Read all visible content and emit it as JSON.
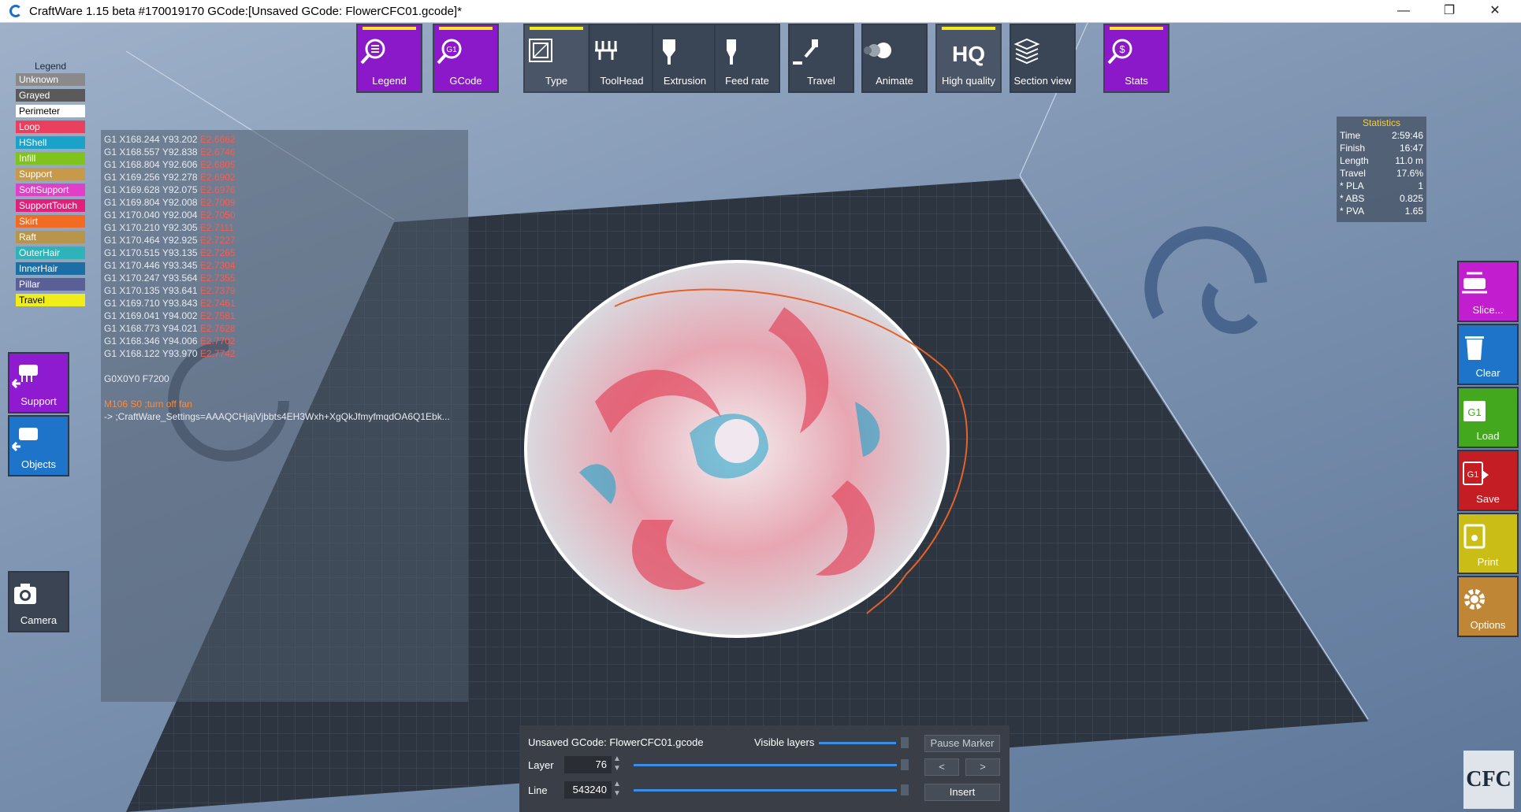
{
  "window": {
    "title": "CraftWare 1.15 beta #170019170   GCode:[Unsaved GCode: FlowerCFC01.gcode]*",
    "minimize": "—",
    "restore": "❐",
    "close": "✕"
  },
  "legend": {
    "header": "Legend",
    "items": [
      {
        "label": "Unknown",
        "color": "#8a8a8a"
      },
      {
        "label": "Grayed",
        "color": "#5a5a5a"
      },
      {
        "label": "Perimeter",
        "color": "#ffffff"
      },
      {
        "label": "Loop",
        "color": "#e9405e"
      },
      {
        "label": "HShell",
        "color": "#1aa2c9"
      },
      {
        "label": "Infill",
        "color": "#7fc31c"
      },
      {
        "label": "Support",
        "color": "#c79a4b"
      },
      {
        "label": "SoftSupport",
        "color": "#e13fc7"
      },
      {
        "label": "SupportTouch",
        "color": "#e0207a"
      },
      {
        "label": "Skirt",
        "color": "#f36a21"
      },
      {
        "label": "Raft",
        "color": "#b8954a"
      },
      {
        "label": "OuterHair",
        "color": "#2db3b8"
      },
      {
        "label": "InnerHair",
        "color": "#1b6fa6"
      },
      {
        "label": "Pillar",
        "color": "#5a5f95"
      },
      {
        "label": "Travel",
        "color": "#f0ee1a"
      }
    ]
  },
  "gcode": {
    "lines": [
      [
        "G1 X168.244 Y93.202 ",
        "E2.6662"
      ],
      [
        "G1 X168.557 Y92.838 ",
        "E2.6746"
      ],
      [
        "G1 X168.804 Y92.606 ",
        "E2.6805"
      ],
      [
        "G1 X169.256 Y92.278 ",
        "E2.6902"
      ],
      [
        "G1 X169.628 Y92.075 ",
        "E2.6976"
      ],
      [
        "G1 X169.804 Y92.008 ",
        "E2.7009"
      ],
      [
        "G1 X170.040 Y92.004 ",
        "E2.7050"
      ],
      [
        "G1 X170.210 Y92.305 ",
        "E2.7111"
      ],
      [
        "G1 X170.464 Y92.925 ",
        "E2.7227"
      ],
      [
        "G1 X170.515 Y93.135 ",
        "E2.7265"
      ],
      [
        "G1 X170.446 Y93.345 ",
        "E2.7304"
      ],
      [
        "G1 X170.247 Y93.564 ",
        "E2.7355"
      ],
      [
        "G1 X170.135 Y93.641 ",
        "E2.7379"
      ],
      [
        "G1 X169.710 Y93.843 ",
        "E2.7461"
      ],
      [
        "G1 X169.041 Y94.002 ",
        "E2.7581"
      ],
      [
        "G1 X168.773 Y94.021 ",
        "E2.7628"
      ],
      [
        "G1 X168.346 Y94.006 ",
        "E2.7702"
      ],
      [
        "G1 X168.122 Y93.970 ",
        "E2.7742"
      ]
    ],
    "g0": "G0X0Y0 F7200",
    "m106": "M106 S0 ;turn off fan",
    "settings": "-> ;CraftWare_Settings=AAAQCHjajVjbbts4EH3Wxh+XgQkJfmyfmqdOA6Q1Ebk..."
  },
  "toolbar": {
    "legend": "Legend",
    "gcode": "GCode",
    "type": "Type",
    "toolhead": "ToolHead",
    "extrusion": "Extrusion",
    "feedrate": "Feed rate",
    "travel": "Travel",
    "animate": "Animate",
    "hq_icon": "HQ",
    "hq": "High quality",
    "section": "Section view",
    "stats": "Stats"
  },
  "statistics": {
    "header": "Statistics",
    "rows": [
      {
        "k": "Time",
        "v": "2:59:46"
      },
      {
        "k": "Finish",
        "v": "16:47"
      },
      {
        "k": "Length",
        "v": "11.0 m"
      },
      {
        "k": "Travel",
        "v": "17.6%"
      },
      {
        "k": " * PLA",
        "v": "1"
      },
      {
        "k": " * ABS",
        "v": "0.825"
      },
      {
        "k": " * PVA",
        "v": "1.65"
      }
    ]
  },
  "left_buttons": {
    "support": "Support",
    "objects": "Objects",
    "camera": "Camera"
  },
  "right_buttons": {
    "slice": "Slice...",
    "clear": "Clear",
    "load": "Load",
    "save": "Save",
    "print": "Print",
    "options": "Options"
  },
  "bottom": {
    "file": "Unsaved GCode: FlowerCFC01.gcode",
    "visible_layers": "Visible layers",
    "layer_label": "Layer",
    "layer_value": "76",
    "line_label": "Line",
    "line_value": "543240",
    "pause_marker": "Pause Marker",
    "prev": "<",
    "next": ">",
    "insert": "Insert"
  },
  "logo_text": "CFC"
}
